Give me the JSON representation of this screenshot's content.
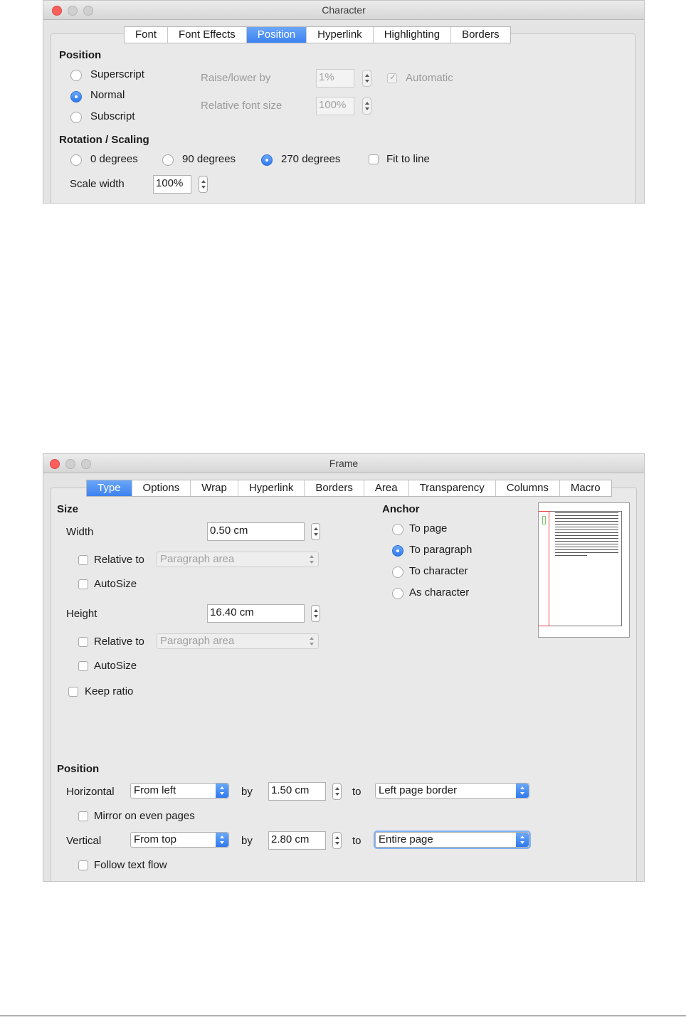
{
  "character": {
    "title": "Character",
    "tabs": [
      "Font",
      "Font Effects",
      "Position",
      "Hyperlink",
      "Highlighting",
      "Borders"
    ],
    "active_tab": "Position",
    "position": {
      "heading": "Position",
      "superscript": "Superscript",
      "normal": "Normal",
      "subscript": "Subscript",
      "raise_label": "Raise/lower by",
      "raise_value": "1%",
      "automatic": "Automatic",
      "relsize_label": "Relative font size",
      "relsize_value": "100%"
    },
    "rotation": {
      "heading": "Rotation / Scaling",
      "deg0": "0 degrees",
      "deg90": "90 degrees",
      "deg270": "270 degrees",
      "fit": "Fit to line",
      "scale_label": "Scale width",
      "scale_value": "100%"
    }
  },
  "frame": {
    "title": "Frame",
    "tabs": [
      "Type",
      "Options",
      "Wrap",
      "Hyperlink",
      "Borders",
      "Area",
      "Transparency",
      "Columns",
      "Macro"
    ],
    "active_tab": "Type",
    "size": {
      "heading": "Size",
      "width_label": "Width",
      "width_value": "0.50 cm",
      "relative_to": "Relative to",
      "relative_value": "Paragraph area",
      "autosize": "AutoSize",
      "height_label": "Height",
      "height_value": "16.40 cm",
      "keep_ratio": "Keep ratio"
    },
    "anchor": {
      "heading": "Anchor",
      "to_page": "To page",
      "to_paragraph": "To paragraph",
      "to_character": "To character",
      "as_character": "As character"
    },
    "position": {
      "heading": "Position",
      "horizontal": "Horizontal",
      "h_mode": "From left",
      "by": "by",
      "h_by": "1.50 cm",
      "to": "to",
      "h_to": "Left page border",
      "mirror": "Mirror on even pages",
      "vertical": "Vertical",
      "v_mode": "From top",
      "v_by": "2.80 cm",
      "v_to": "Entire page",
      "follow": "Follow text flow"
    }
  }
}
